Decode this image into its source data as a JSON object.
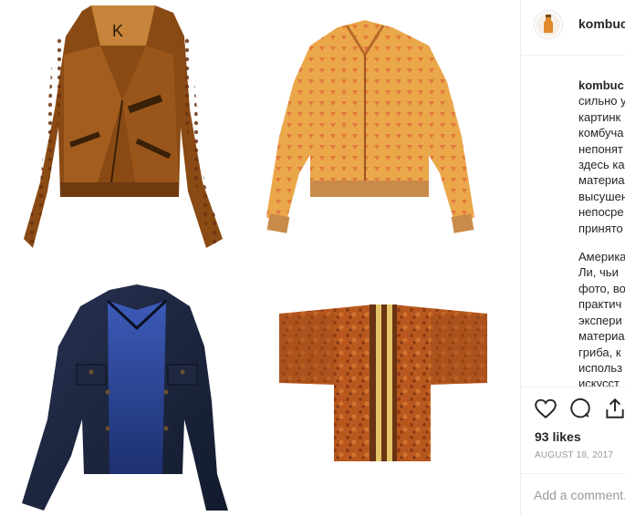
{
  "post": {
    "username": "kombuch",
    "caption_user": "kombuc",
    "caption_paragraph1": [
      "сильно у",
      "картинк",
      "комбуча",
      "непонят",
      "здесь ка",
      "материа",
      "высушен",
      "непосре",
      "принято"
    ],
    "caption_paragraph2": [
      "Америка",
      "Ли, чьи",
      "фото, во",
      "практич",
      "экспери",
      "материа",
      "гриба, к",
      "использ",
      "искусст"
    ],
    "likes": "93 likes",
    "date": "AUGUST 18, 2017",
    "comment_placeholder": "Add a comment..."
  },
  "colors": {
    "leather_brown": "#8a4a14",
    "bomber_orange": "#eaa84a",
    "denim_navy": "#1b2238",
    "kimono_rust": "#b45a22"
  },
  "icons": [
    "heart-icon",
    "comment-icon",
    "share-icon"
  ]
}
